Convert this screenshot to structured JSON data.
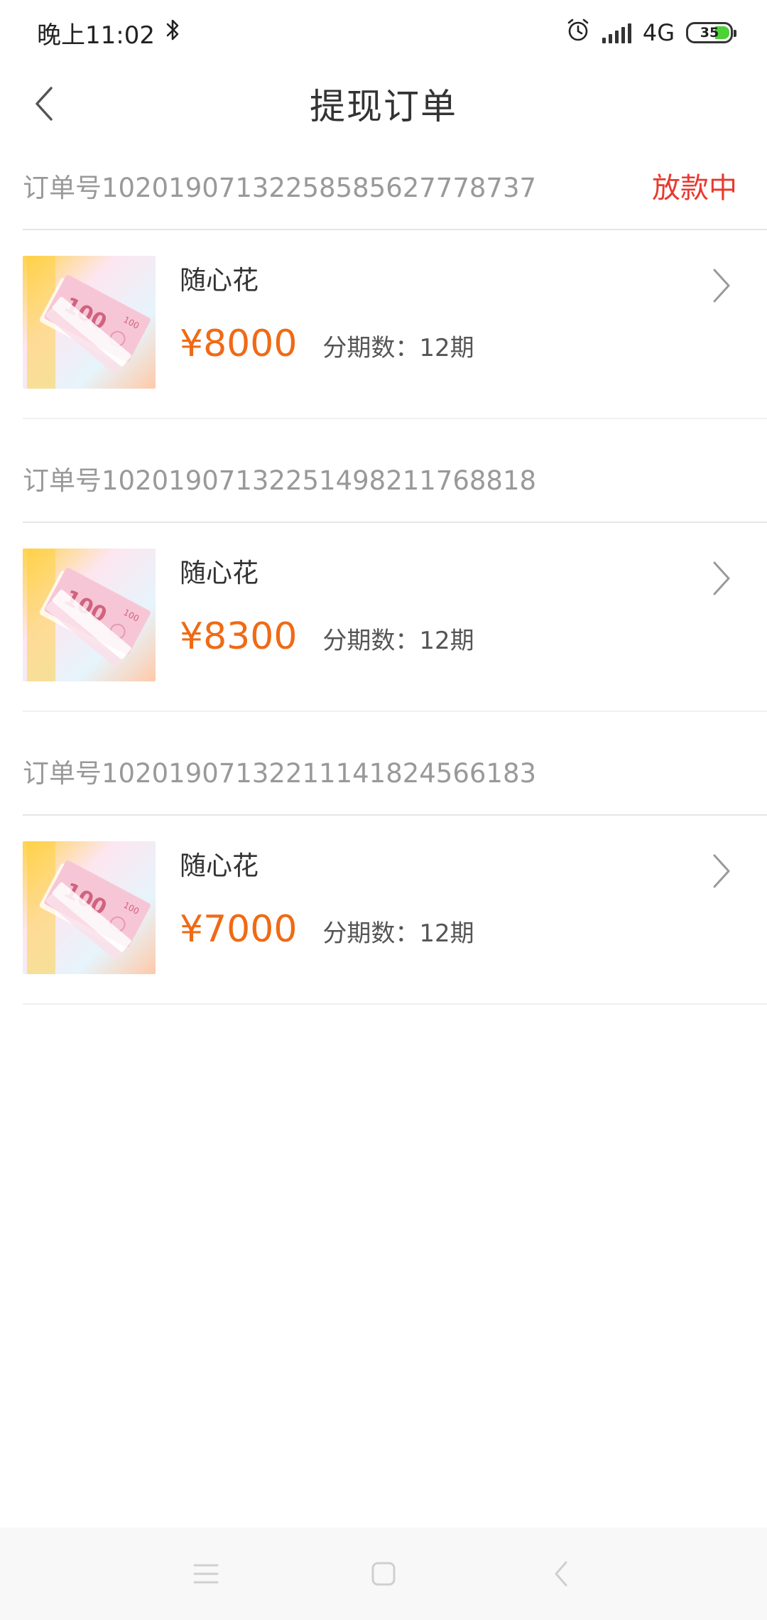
{
  "status_bar": {
    "time": "晚上11:02",
    "bluetooth_icon": "bluetooth-icon",
    "network": "4G",
    "battery": "35"
  },
  "header": {
    "title": "提现订单",
    "back_icon": "chevron-left-icon"
  },
  "orders": [
    {
      "order_no": "订单号10201907132258585627778737",
      "status": "放款中",
      "product_name": "随心花",
      "price": "¥8000",
      "periods": "分期数：12期"
    },
    {
      "order_no": "订单号10201907132251498211768818",
      "status": "",
      "product_name": "随心花",
      "price": "¥8300",
      "periods": "分期数：12期"
    },
    {
      "order_no": "订单号10201907132211141824566183",
      "status": "",
      "product_name": "随心花",
      "price": "¥7000",
      "periods": "分期数：12期"
    }
  ],
  "colors": {
    "price": "#f06a14",
    "status": "#e83a2f",
    "muted": "#999999"
  }
}
